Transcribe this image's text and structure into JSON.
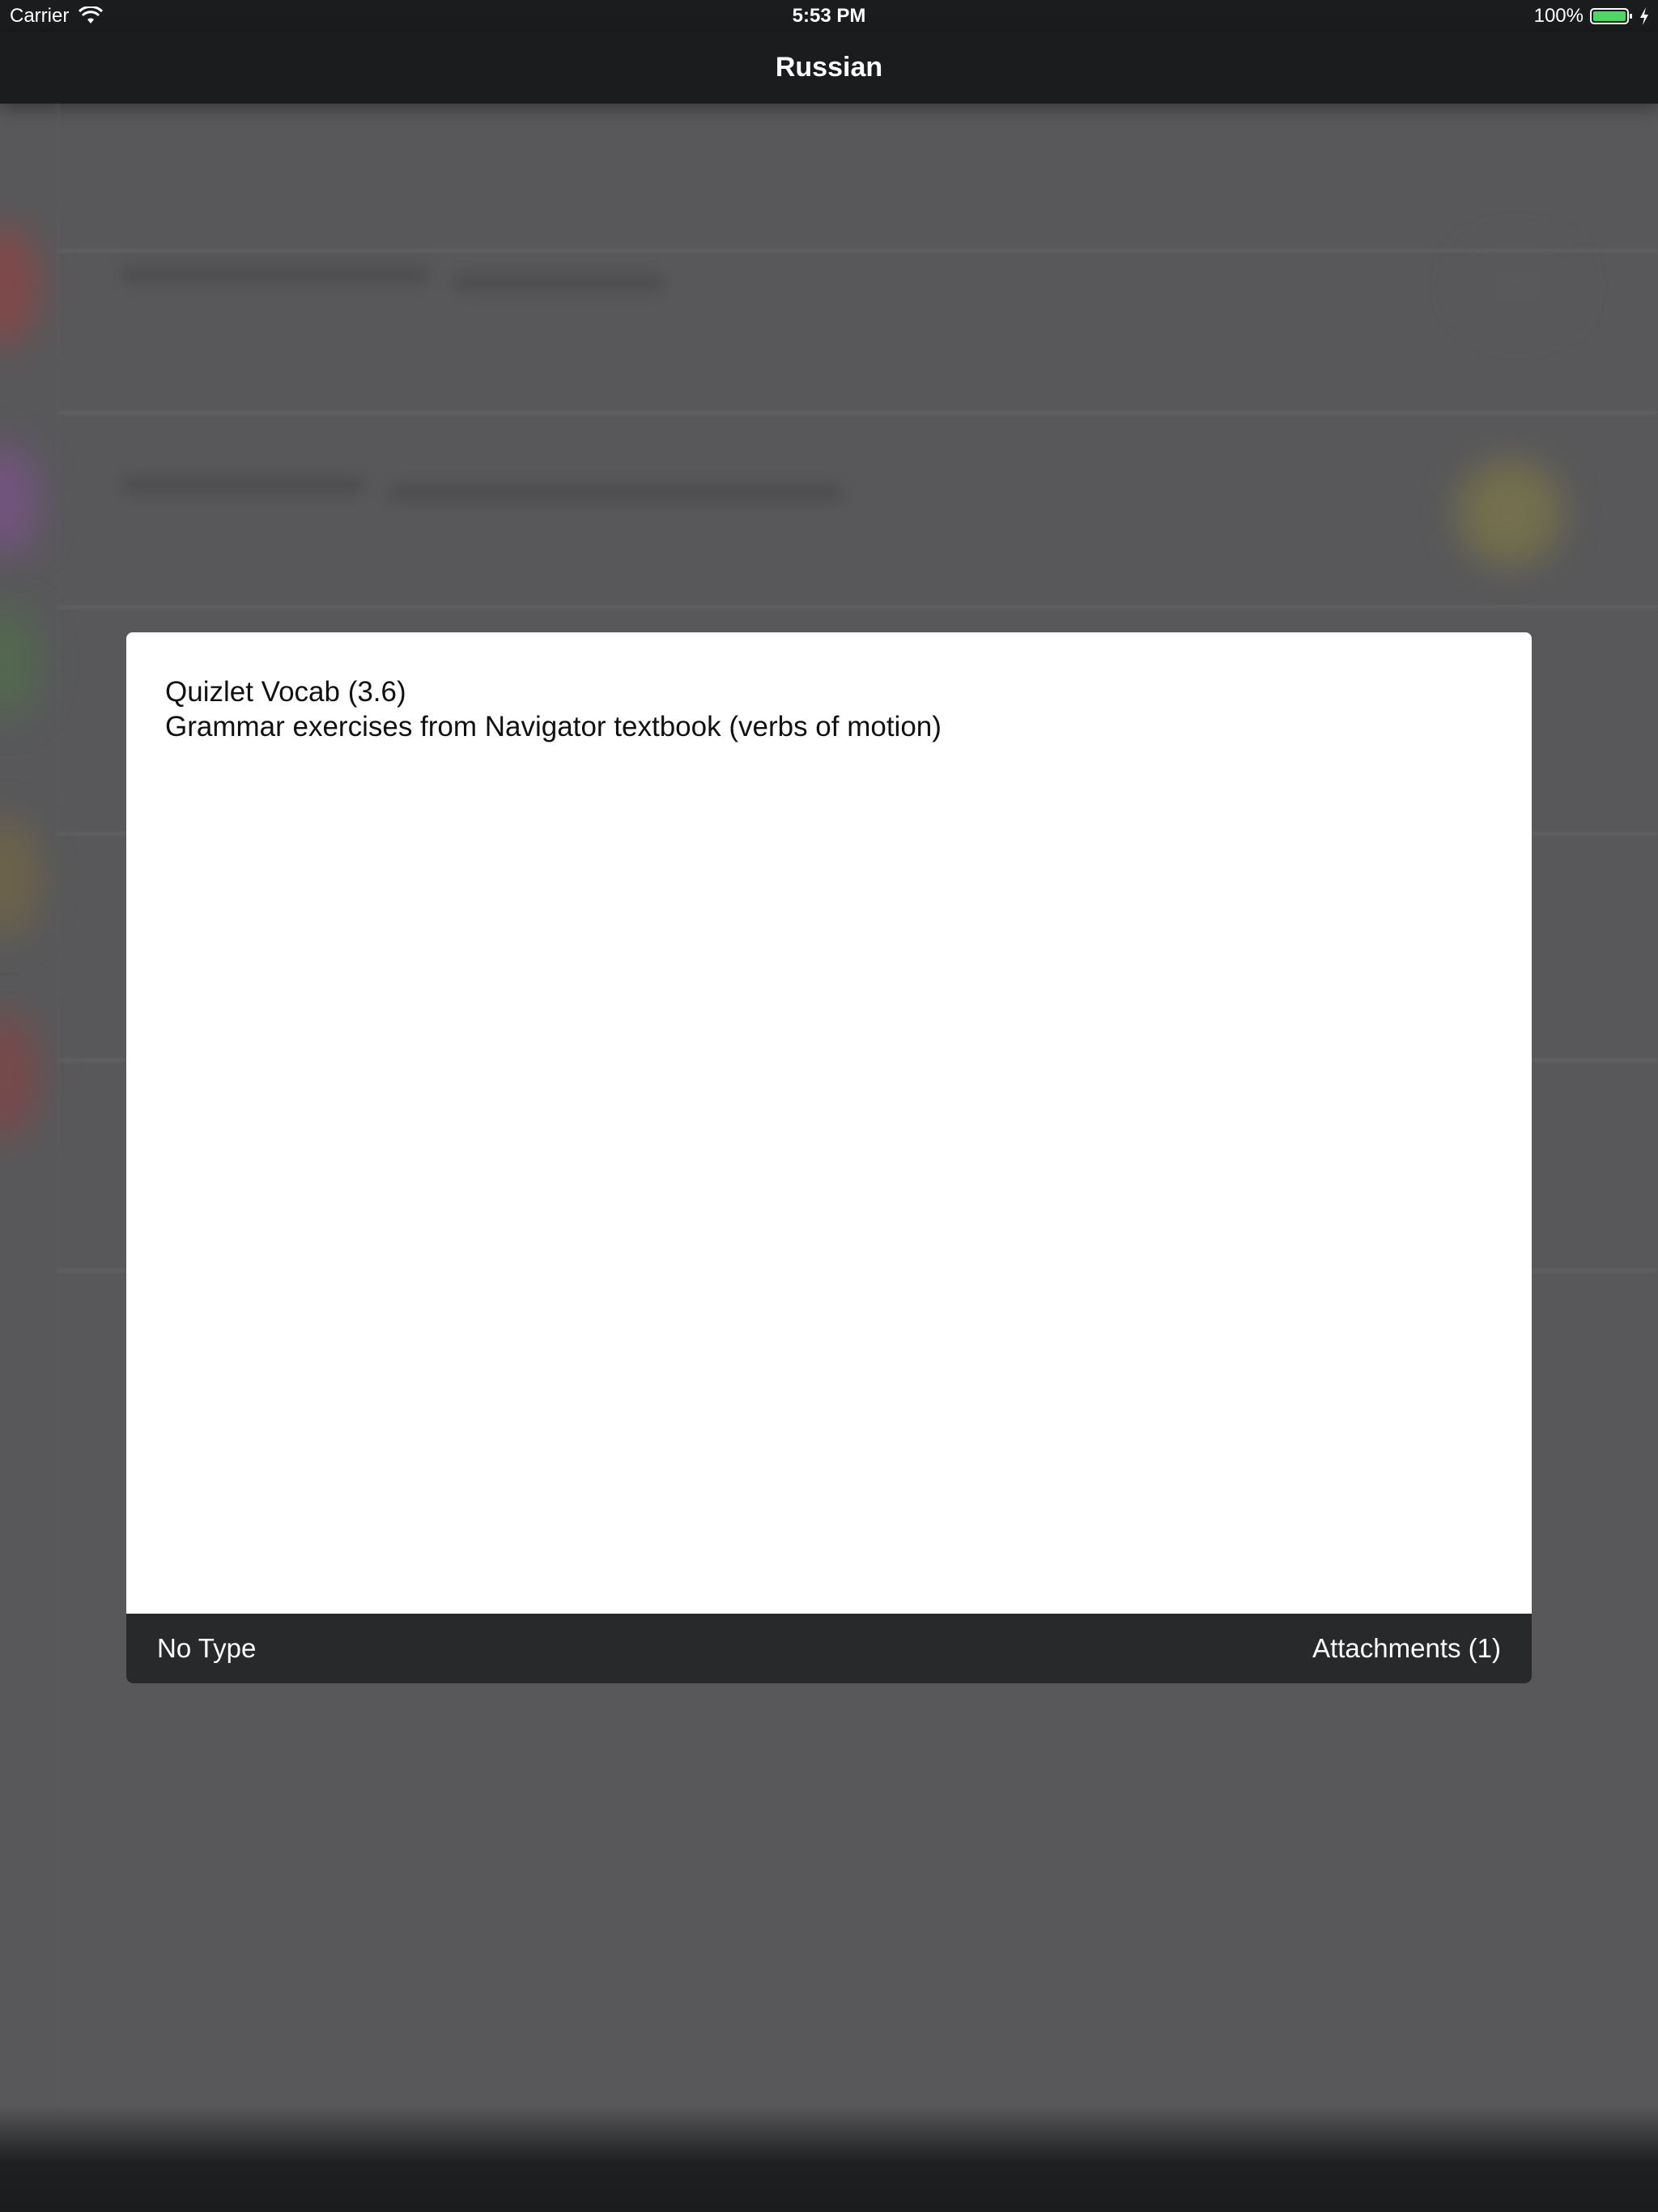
{
  "status_bar": {
    "carrier": "Carrier",
    "time": "5:53 PM",
    "battery": "100%",
    "battery_color": "#4cd964"
  },
  "nav": {
    "title": "Russian"
  },
  "modal": {
    "lines": [
      "Quizlet Vocab (3.6)",
      "Grammar exercises from Navigator textbook (verbs of motion)"
    ],
    "footer": {
      "type_label": "No Type",
      "attachments_label": "Attachments (1)"
    }
  },
  "colors": {
    "bar_background": "#1b1c1e",
    "dim_background": "#58585a",
    "footer_background": "#27292b"
  }
}
